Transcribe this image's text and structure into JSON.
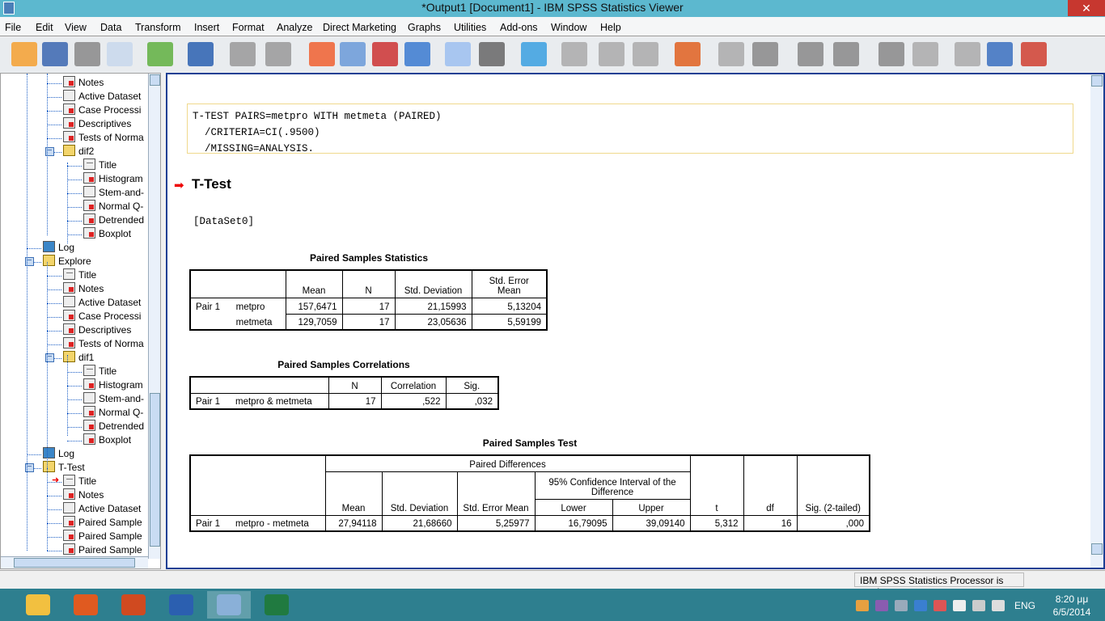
{
  "window": {
    "title": "*Output1 [Document1] - IBM SPSS Statistics Viewer",
    "close": "✕"
  },
  "menu": [
    "File",
    "Edit",
    "View",
    "Data",
    "Transform",
    "Insert",
    "Format",
    "Analyze",
    "Direct Marketing",
    "Graphs",
    "Utilities",
    "Add-ons",
    "Window",
    "Help"
  ],
  "toolbar_icons": [
    "open-icon",
    "save-icon",
    "print-icon",
    "print-preview-icon",
    "export-icon",
    "recall-dialog-icon",
    "undo-icon",
    "redo-icon",
    "goto-data-icon",
    "goto-case-icon",
    "goto-variable-icon",
    "variables-icon",
    "use-sets-icon",
    "show-all-icon",
    "designate-window-icon",
    "pivot-icon",
    "insert-heading-icon",
    "insert-title-icon",
    "insert-text-icon",
    "insert-chart-icon",
    "back-icon",
    "forward-icon",
    "expand-icon",
    "collapse-icon",
    "show-icon",
    "hide-icon",
    "select-last-output-icon",
    "insert-output-icon",
    "designate-icon"
  ],
  "tree": [
    {
      "label": "Notes",
      "level": 2,
      "icon": "notes"
    },
    {
      "label": "Active Dataset",
      "level": 2,
      "icon": "doc"
    },
    {
      "label": "Case Processi",
      "level": 2,
      "icon": "table"
    },
    {
      "label": "Descriptives",
      "level": 2,
      "icon": "table"
    },
    {
      "label": "Tests of Norma",
      "level": 2,
      "icon": "table"
    },
    {
      "label": "dif2",
      "level": 2,
      "icon": "book",
      "expanded": true
    },
    {
      "label": "Title",
      "level": 3,
      "icon": "title"
    },
    {
      "label": "Histogram",
      "level": 3,
      "icon": "chart"
    },
    {
      "label": "Stem-and-",
      "level": 3,
      "icon": "doc"
    },
    {
      "label": "Normal Q-",
      "level": 3,
      "icon": "chart"
    },
    {
      "label": "Detrended",
      "level": 3,
      "icon": "chart"
    },
    {
      "label": "Boxplot",
      "level": 3,
      "icon": "chart"
    },
    {
      "label": "Log",
      "level": 1,
      "icon": "log"
    },
    {
      "label": "Explore",
      "level": 1,
      "icon": "book",
      "expanded": true
    },
    {
      "label": "Title",
      "level": 2,
      "icon": "title"
    },
    {
      "label": "Notes",
      "level": 2,
      "icon": "notes"
    },
    {
      "label": "Active Dataset",
      "level": 2,
      "icon": "doc"
    },
    {
      "label": "Case Processi",
      "level": 2,
      "icon": "table"
    },
    {
      "label": "Descriptives",
      "level": 2,
      "icon": "table"
    },
    {
      "label": "Tests of Norma",
      "level": 2,
      "icon": "table"
    },
    {
      "label": "dif1",
      "level": 2,
      "icon": "book",
      "expanded": true
    },
    {
      "label": "Title",
      "level": 3,
      "icon": "title"
    },
    {
      "label": "Histogram",
      "level": 3,
      "icon": "chart"
    },
    {
      "label": "Stem-and-",
      "level": 3,
      "icon": "doc"
    },
    {
      "label": "Normal Q-",
      "level": 3,
      "icon": "chart"
    },
    {
      "label": "Detrended",
      "level": 3,
      "icon": "chart"
    },
    {
      "label": "Boxplot",
      "level": 3,
      "icon": "chart"
    },
    {
      "label": "Log",
      "level": 1,
      "icon": "log"
    },
    {
      "label": "T-Test",
      "level": 1,
      "icon": "book",
      "expanded": true
    },
    {
      "label": "Title",
      "level": 2,
      "icon": "title",
      "current": true
    },
    {
      "label": "Notes",
      "level": 2,
      "icon": "notes"
    },
    {
      "label": "Active Dataset",
      "level": 2,
      "icon": "doc"
    },
    {
      "label": "Paired Sample",
      "level": 2,
      "icon": "table"
    },
    {
      "label": "Paired Sample",
      "level": 2,
      "icon": "table"
    },
    {
      "label": "Paired Sample",
      "level": 2,
      "icon": "table"
    }
  ],
  "viewer": {
    "syntax": "T-TEST PAIRS=metpro WITH metmeta (PAIRED)\n  /CRITERIA=CI(.9500)\n  /MISSING=ANALYSIS.",
    "heading": "T-Test",
    "dataset": "[DataSet0]",
    "stats": {
      "caption": "Paired Samples Statistics",
      "headers": [
        "Mean",
        "N",
        "Std. Deviation",
        "Std. Error Mean"
      ],
      "pair": "Pair 1",
      "rows": [
        [
          "metpro",
          "157,6471",
          "17",
          "21,15993",
          "5,13204"
        ],
        [
          "metmeta",
          "129,7059",
          "17",
          "23,05636",
          "5,59199"
        ]
      ]
    },
    "corr": {
      "caption": "Paired Samples Correlations",
      "headers": [
        "N",
        "Correlation",
        "Sig."
      ],
      "row": [
        "Pair 1",
        "metpro & metmeta",
        "17",
        ",522",
        ",032"
      ]
    },
    "test": {
      "caption": "Paired Samples Test",
      "group": "Paired Differences",
      "ci": "95% Confidence Interval of the Difference",
      "headers": [
        "Mean",
        "Std. Deviation",
        "Std. Error Mean",
        "Lower",
        "Upper",
        "t",
        "df",
        "Sig. (2-tailed)"
      ],
      "row": [
        "Pair 1",
        "metpro - metmeta",
        "27,94118",
        "21,68660",
        "5,25977",
        "16,79095",
        "39,09140",
        "5,312",
        "16",
        ",000"
      ]
    }
  },
  "status": "IBM SPSS Statistics Processor is ready",
  "taskbar": {
    "apps": [
      "file-explorer",
      "firefox",
      "powerpoint",
      "word",
      "spss",
      "excel"
    ],
    "lang": "ENG",
    "time": "8:20 μμ",
    "date": "6/5/2014"
  }
}
